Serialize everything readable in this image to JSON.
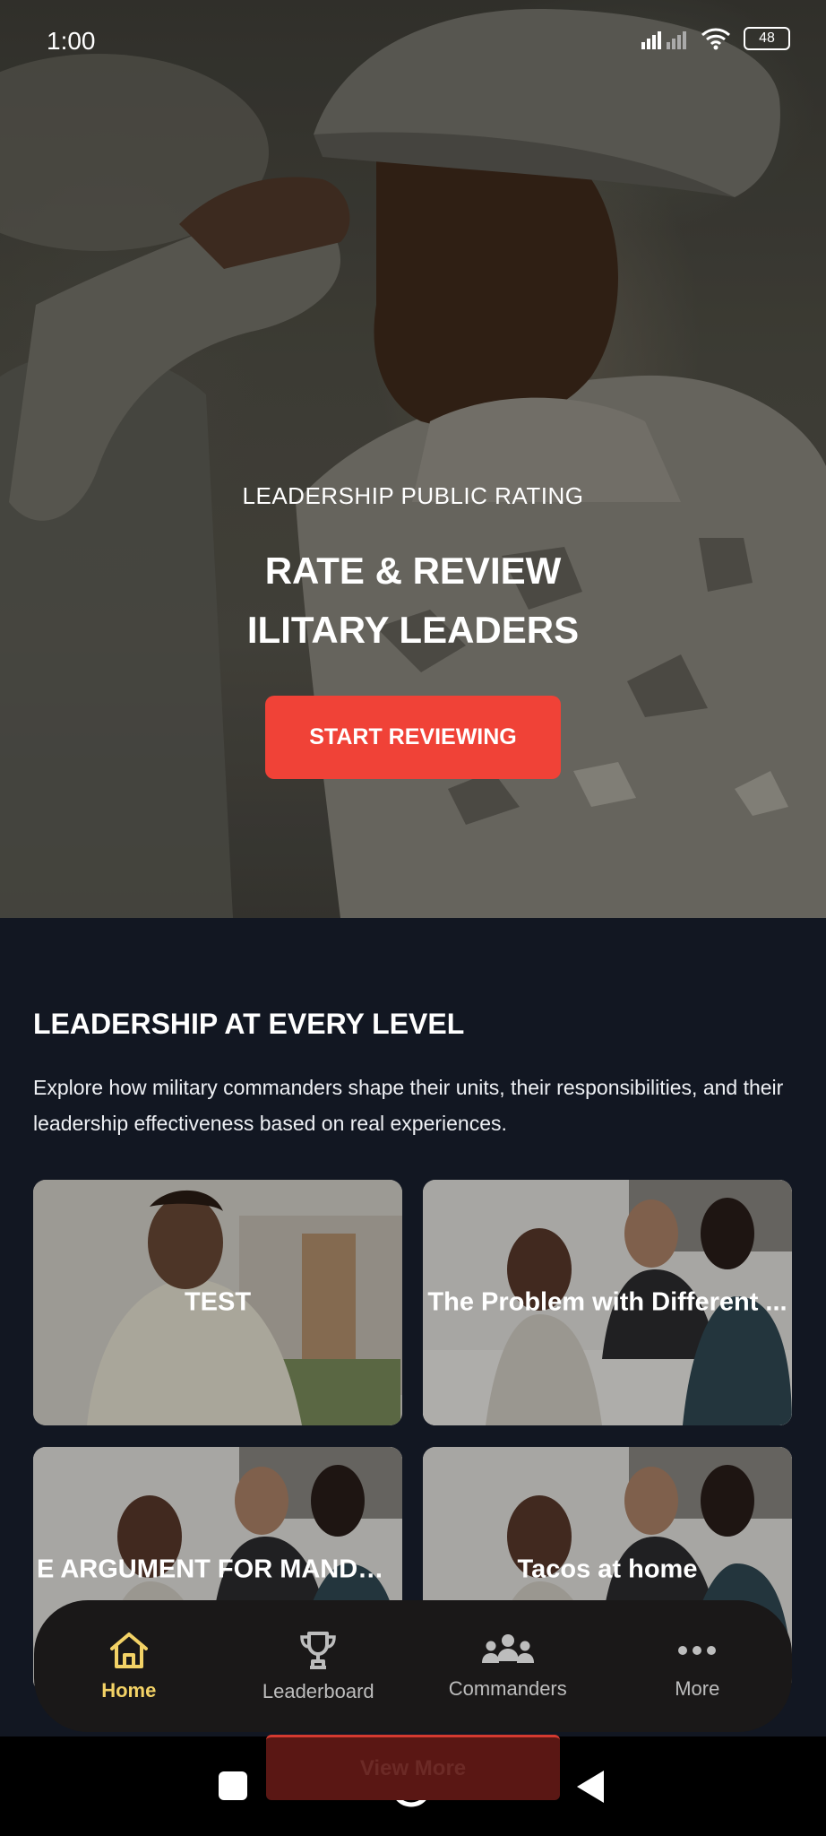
{
  "status_bar": {
    "time": "1:00",
    "battery": "48"
  },
  "hero": {
    "eyebrow": "LEADERSHIP PUBLIC RATING",
    "title_line1": "RATE & REVIEW",
    "title_line2": "ILITARY LEADERS",
    "cta_label": "START REVIEWING"
  },
  "section": {
    "title": "LEADERSHIP AT EVERY LEVEL",
    "description": "Explore how military commanders shape their units, their responsibilities, and their leadership effectiveness based on real experiences."
  },
  "cards": [
    {
      "title": "TEST"
    },
    {
      "title": "The Problem with Different ..."
    },
    {
      "title": "E ARGUMENT FOR MANDATO..."
    },
    {
      "title": "Tacos at home"
    }
  ],
  "view_more_label": "View More",
  "bottom_nav": {
    "items": [
      {
        "label": "Home",
        "icon": "home-icon",
        "active": true
      },
      {
        "label": "Leaderboard",
        "icon": "trophy-icon",
        "active": false
      },
      {
        "label": "Commanders",
        "icon": "group-icon",
        "active": false
      },
      {
        "label": "More",
        "icon": "more-dots-icon",
        "active": false
      }
    ]
  },
  "colors": {
    "accent_red": "#f04237",
    "active_nav": "#f3d266",
    "background": "#121722",
    "nav_bg": "#1a1818"
  }
}
